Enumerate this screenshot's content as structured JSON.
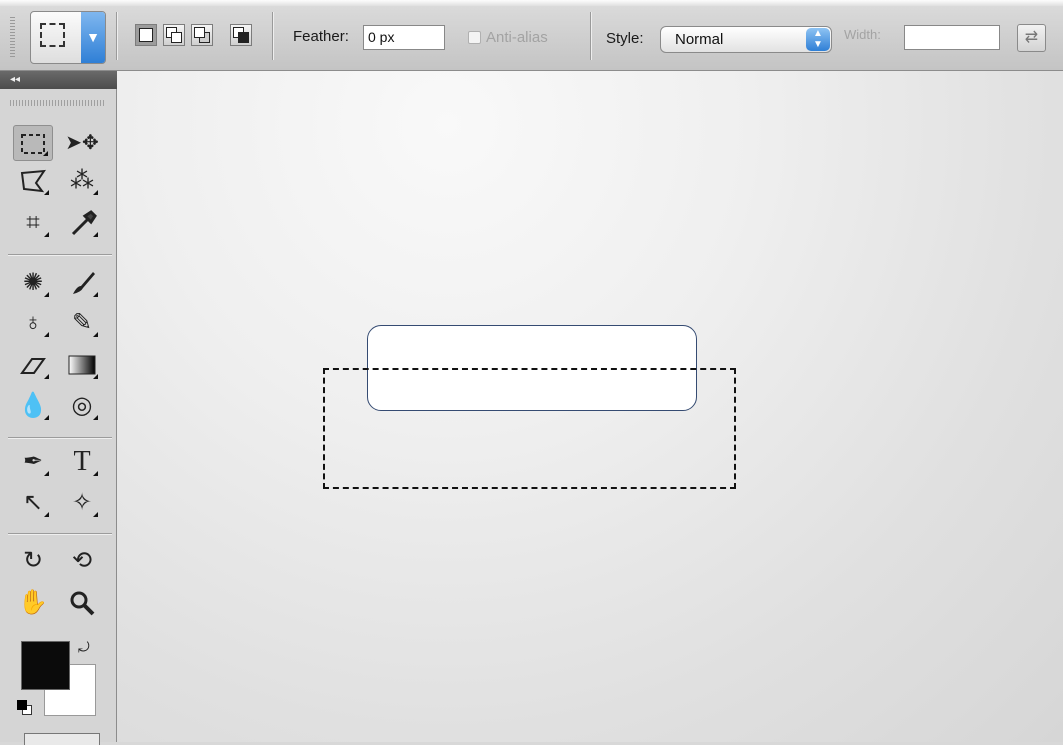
{
  "options_bar": {
    "tool_preset_icon": "rectangular-marquee-icon",
    "selection_modes": [
      "new-selection-icon",
      "add-to-selection-icon",
      "subtract-from-selection-icon",
      "intersect-with-selection-icon"
    ],
    "feather_label": "Feather:",
    "feather_value": "0 px",
    "antialias_label": "Anti-alias",
    "antialias_checked": false,
    "style_label": "Style:",
    "style_value": "Normal",
    "width_label": "Width:",
    "width_value": ""
  },
  "toolbox": {
    "collapse_label": "◂◂",
    "tools": [
      "rectangular-marquee-icon",
      "move-icon",
      "lasso-icon",
      "magic-wand-icon",
      "crop-icon",
      "eyedropper-icon",
      "spot-healing-icon",
      "brush-icon",
      "clone-stamp-icon",
      "history-brush-icon",
      "eraser-icon",
      "gradient-icon",
      "blur-icon",
      "dodge-icon",
      "pen-icon",
      "type-icon",
      "path-selection-icon",
      "custom-shape-icon",
      "rotate-view-icon",
      "3d-rotate-icon",
      "hand-icon",
      "zoom-icon"
    ],
    "foreground_color": "#0b0b0b",
    "background_color": "#ffffff"
  },
  "colors": {
    "accent": "#2f7fd6",
    "shape_stroke": "#354b72"
  }
}
